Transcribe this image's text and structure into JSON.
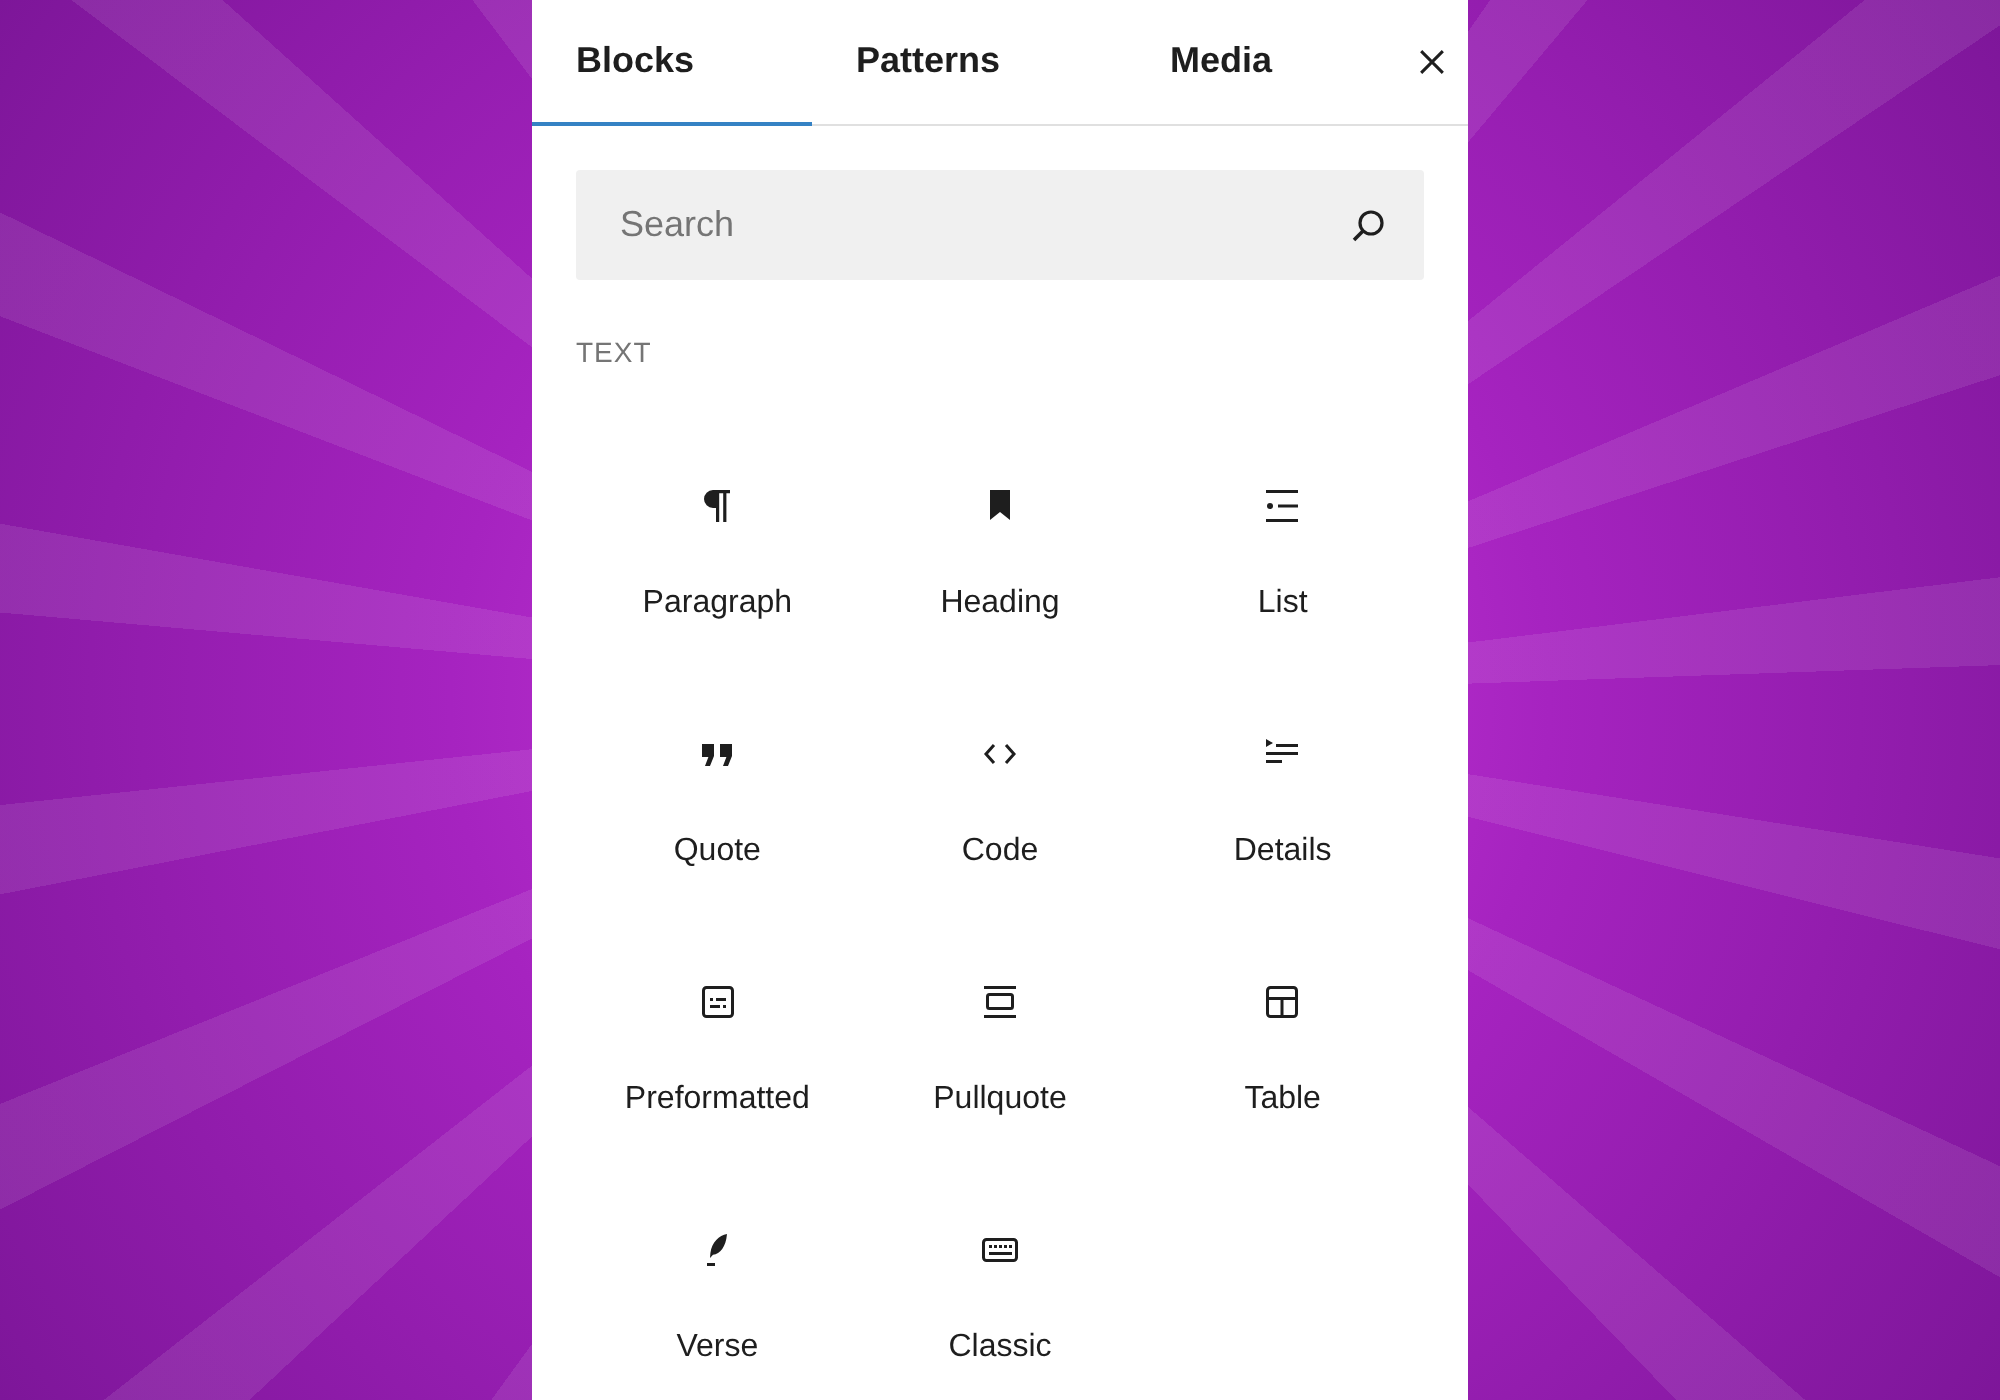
{
  "tabs": [
    {
      "label": "Blocks",
      "selected": true
    },
    {
      "label": "Patterns",
      "selected": false
    },
    {
      "label": "Media",
      "selected": false
    }
  ],
  "search": {
    "placeholder": "Search"
  },
  "category": "TEXT",
  "blocks": [
    {
      "kind": "paragraph",
      "label": "Paragraph"
    },
    {
      "kind": "heading",
      "label": "Heading"
    },
    {
      "kind": "list",
      "label": "List"
    },
    {
      "kind": "quote",
      "label": "Quote"
    },
    {
      "kind": "code",
      "label": "Code"
    },
    {
      "kind": "details",
      "label": "Details"
    },
    {
      "kind": "preformatted",
      "label": "Preformatted"
    },
    {
      "kind": "pullquote",
      "label": "Pullquote"
    },
    {
      "kind": "table",
      "label": "Table"
    },
    {
      "kind": "verse",
      "label": "Verse"
    },
    {
      "kind": "classic",
      "label": "Classic"
    }
  ]
}
